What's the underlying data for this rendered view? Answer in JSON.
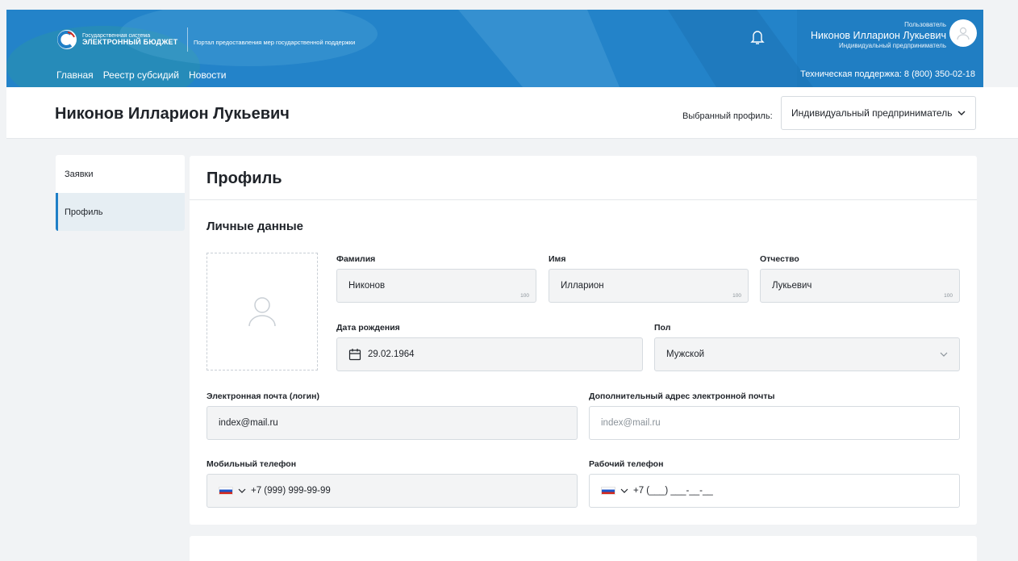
{
  "header": {
    "logo_small": "Государственная система",
    "logo_big": "ЭЛЕКТРОННЫЙ БЮДЖЕТ",
    "portal": "Портал предоставления мер государственной поддержки",
    "nav": [
      "Главная",
      "Реестр субсидий",
      "Новости"
    ],
    "user_caption": "Пользователь",
    "user_name": "Никонов Илларион Лукьевич",
    "user_role": "Индивидуальный предприниматель",
    "support": "Техническая поддержка: 8 (800) 350-02-18",
    "color": "#1f7fc7"
  },
  "titlebar": {
    "name": "Никонов Илларион Лукьевич",
    "profile_label": "Выбранный профиль:",
    "profile_value": "Индивидуальный предприниматель"
  },
  "sidemenu": {
    "items": [
      "Заявки",
      "Профиль"
    ],
    "active": "Профиль"
  },
  "profile": {
    "title": "Профиль",
    "section": "Личные данные",
    "surname_label": "Фамилия",
    "surname": "Никонов",
    "surname_max": "100",
    "name_label": "Имя",
    "name": "Илларион",
    "name_max": "100",
    "patronymic_label": "Отчество",
    "patronymic": "Лукьевич",
    "patronymic_max": "100",
    "birth_label": "Дата рождения",
    "birth": "29.02.1964",
    "gender_label": "Пол",
    "gender": "Мужской",
    "email_label": "Электронная почта (логин)",
    "email": "index@mail.ru",
    "email2_label": "Дополнительный адрес электронной почты",
    "email2_placeholder": "index@mail.ru",
    "mobile_label": "Мобильный телефон",
    "mobile": "+7 (999) 999-99-99",
    "work_label": "Рабочий телефон",
    "work_placeholder": "+7 (___) ___-__-__"
  }
}
